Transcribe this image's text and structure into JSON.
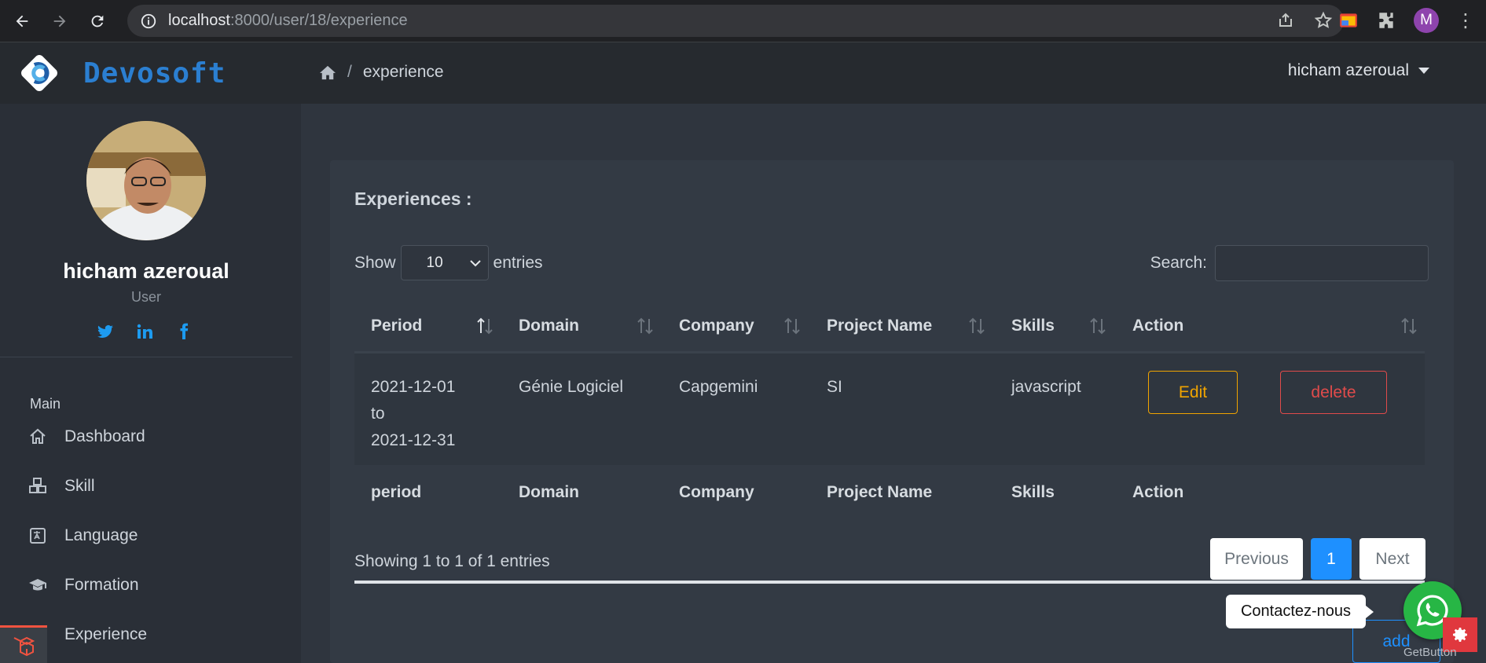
{
  "browser": {
    "url_host": "localhost",
    "url_path": ":8000/user/18/experience",
    "profile_initial": "M"
  },
  "header": {
    "brand": "Devosoft",
    "breadcrumb_current": "experience",
    "user_name": "hicham azeroual"
  },
  "sidebar": {
    "name": "hicham azeroual",
    "role": "User",
    "section_label": "Main",
    "items": [
      {
        "label": "Dashboard",
        "icon": "home-icon"
      },
      {
        "label": "Skill",
        "icon": "cubes-icon"
      },
      {
        "label": "Language",
        "icon": "language-icon"
      },
      {
        "label": "Formation",
        "icon": "graduation-cap-icon"
      },
      {
        "label": "Experience",
        "icon": "laravel-icon"
      }
    ]
  },
  "main": {
    "title": "Experiences :",
    "show_label": "Show",
    "entries_value": "10",
    "entries_label": "entries",
    "search_label": "Search:",
    "columns": [
      "Period",
      "Domain",
      "Company",
      "Project Name",
      "Skills",
      "Action"
    ],
    "footer_columns": [
      "period",
      "Domain",
      "Company",
      "Project Name",
      "Skills",
      "Action"
    ],
    "rows": [
      {
        "period_start": "2021-12-01",
        "period_to": "to",
        "period_end": "2021-12-31",
        "domain": "Génie Logiciel",
        "company": "Capgemini",
        "project": "SI",
        "skills": "javascript",
        "edit_label": "Edit",
        "delete_label": "delete"
      }
    ],
    "info": "Showing 1 to 1 of 1 entries",
    "pagination": {
      "previous": "Previous",
      "page": "1",
      "next": "Next"
    },
    "add_label": "add"
  },
  "widgets": {
    "contact_label": "Contactez-nous",
    "getbutton": "GetButton"
  },
  "colors": {
    "accent": "#1e90ff",
    "edit": "#f0a400",
    "delete": "#e04b4b",
    "whatsapp": "#27b645"
  }
}
